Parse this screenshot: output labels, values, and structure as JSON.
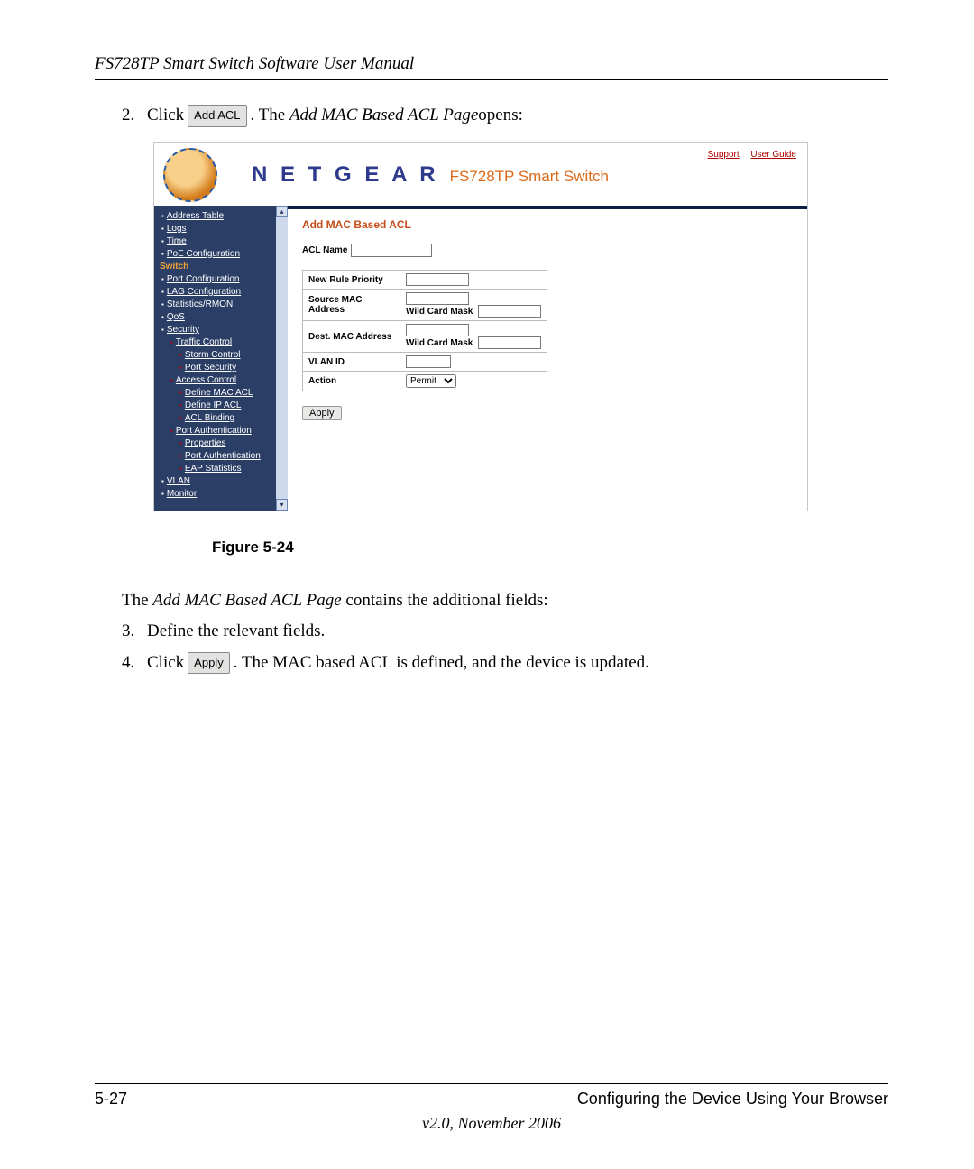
{
  "doc": {
    "header_title": "FS728TP Smart Switch Software User Manual",
    "steps": {
      "s2_pre": "Click",
      "s2_btn": "Add ACL",
      "s2_post": ". The ",
      "s2_italic": "Add MAC Based ACL Page",
      "s2_end": " opens:",
      "s3": "Define the relevant fields.",
      "s4_pre": "Click ",
      "s4_btn": "Apply",
      "s4_post": ". The MAC based ACL is defined, and the device is updated."
    },
    "figure_caption": "Figure 5-24",
    "after_figure": "The Add MAC Based ACL Page contains the additional fields:",
    "after_figure_italic": "Add MAC Based ACL Page",
    "footer_left": "5-27",
    "footer_right": "Configuring the Device Using Your Browser",
    "footer_version": "v2.0, November 2006"
  },
  "ui": {
    "brand": "N E T G E A R",
    "brand_sub": "FS728TP Smart Switch",
    "hdr_links": {
      "support": "Support",
      "guide": "User Guide"
    },
    "nav": {
      "address_table": "Address Table",
      "logs": "Logs",
      "time": "Time",
      "poe": "PoE Configuration",
      "switch": "Switch",
      "port_config": "Port Configuration",
      "lag_config": "LAG Configuration",
      "stats": "Statistics/RMON",
      "qos": "QoS",
      "security": "Security",
      "traffic_control": "Traffic Control",
      "storm_control": "Storm Control",
      "port_security": "Port Security",
      "access_control": "Access Control",
      "define_mac_acl": "Define MAC ACL",
      "define_ip_acl": "Define IP ACL",
      "acl_binding": "ACL Binding",
      "port_auth": "Port Authentication",
      "properties": "Properties",
      "port_auth2": "Port Authentication",
      "eap_stats": "EAP Statistics",
      "vlan": "VLAN",
      "monitor": "Monitor"
    },
    "form": {
      "title": "Add MAC Based ACL",
      "acl_name": "ACL Name",
      "new_rule_priority": "New Rule Priority",
      "source_mac": "Source MAC Address",
      "wild_card_mask": "Wild Card Mask",
      "dest_mac": "Dest. MAC Address",
      "vlan_id": "VLAN ID",
      "action": "Action",
      "action_value": "Permit",
      "apply": "Apply"
    }
  }
}
